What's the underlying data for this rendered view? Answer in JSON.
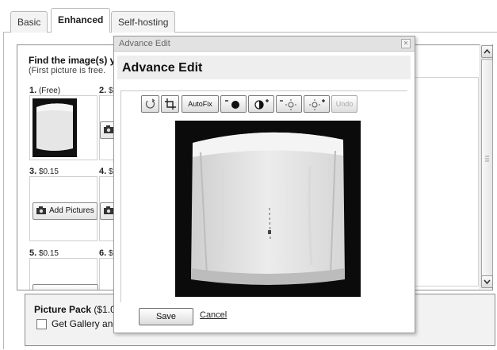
{
  "tabs": [
    {
      "label": "Basic"
    },
    {
      "label": "Enhanced"
    },
    {
      "label": "Self-hosting"
    }
  ],
  "find": {
    "title": "Find the image(s) yo",
    "subtitle": "(First picture is free."
  },
  "slots": [
    {
      "num": "1.",
      "price": "(Free)"
    },
    {
      "num": "2.",
      "price": "$"
    },
    {
      "num": "3.",
      "price": "$0.15"
    },
    {
      "num": "4.",
      "price": "$"
    },
    {
      "num": "5.",
      "price": "$0.15"
    },
    {
      "num": "6.",
      "price": "$"
    }
  ],
  "add_pictures_label": "Add Pictures",
  "picture_pack": {
    "title": "Picture Pack",
    "price": "($1.0",
    "checkbox_label": "Get Gallery and"
  },
  "modal": {
    "bar_title": "Advance Edit",
    "heading": "Advance Edit",
    "toolbar": {
      "autofix": "AutoFix",
      "undo": "Undo"
    },
    "save": "Save",
    "cancel": "Cancel"
  },
  "colors": {
    "accent_border": "#8e8e8e",
    "modal_bar": "#e2e2e2",
    "photo_bg": "#0b0b0b"
  }
}
